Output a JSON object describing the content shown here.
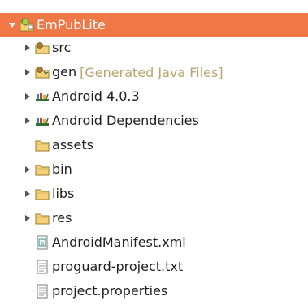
{
  "tree": {
    "root": {
      "label": "EmPubLite",
      "icon": "android-project-icon",
      "expanded": true,
      "selected": true,
      "selection_color": "#f07746"
    },
    "items": [
      {
        "label": "src",
        "icon": "source-folder-icon",
        "expandable": true,
        "decoration": ""
      },
      {
        "label": "gen",
        "icon": "generated-source-folder-icon",
        "expandable": true,
        "decoration": "[Generated Java Files]"
      },
      {
        "label": "Android 4.0.3",
        "icon": "library-icon",
        "expandable": true,
        "decoration": ""
      },
      {
        "label": "Android Dependencies",
        "icon": "library-icon",
        "expandable": true,
        "decoration": ""
      },
      {
        "label": "assets",
        "icon": "folder-icon",
        "expandable": false,
        "decoration": ""
      },
      {
        "label": "bin",
        "icon": "folder-icon",
        "expandable": true,
        "decoration": ""
      },
      {
        "label": "libs",
        "icon": "folder-icon",
        "expandable": true,
        "decoration": ""
      },
      {
        "label": "res",
        "icon": "folder-icon",
        "expandable": true,
        "decoration": ""
      },
      {
        "label": "AndroidManifest.xml",
        "icon": "android-manifest-file-icon",
        "expandable": false,
        "decoration": ""
      },
      {
        "label": "proguard-project.txt",
        "icon": "text-file-icon",
        "expandable": false,
        "decoration": ""
      },
      {
        "label": "project.properties",
        "icon": "text-file-icon",
        "expandable": false,
        "decoration": ""
      }
    ]
  }
}
